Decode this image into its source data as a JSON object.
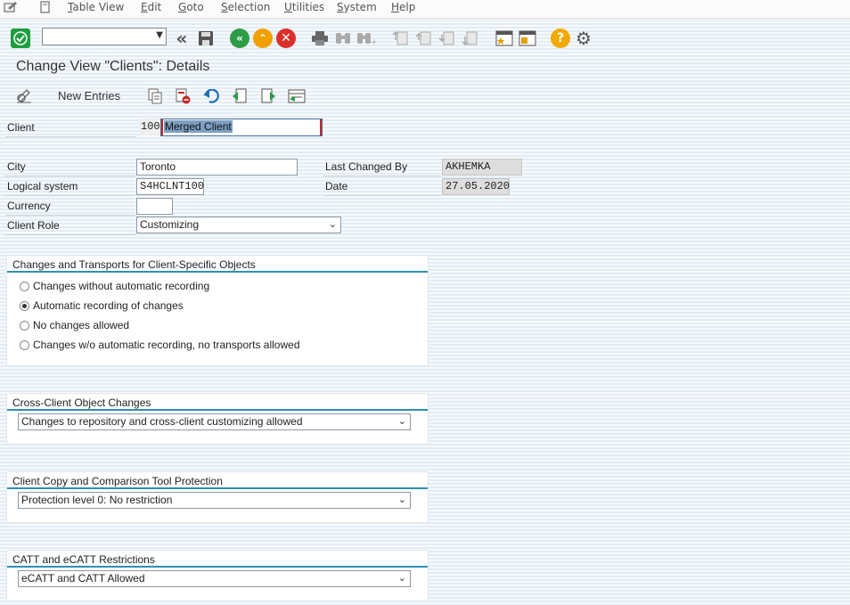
{
  "menu": {
    "items": [
      "Table View",
      "Edit",
      "Goto",
      "Selection",
      "Utilities",
      "System",
      "Help"
    ],
    "mnemonics": [
      "T",
      "E",
      "G",
      "S",
      "U",
      "S",
      "H"
    ]
  },
  "toolbar": {
    "command_field_value": "",
    "icons": [
      "enter-icon",
      "back-double-icon",
      "save-icon",
      "back-icon",
      "exit-icon",
      "cancel-icon",
      "print-icon",
      "find-icon",
      "find-next-icon",
      "first-page-icon",
      "previous-page-icon",
      "next-page-icon",
      "last-page-icon",
      "create-session-icon",
      "shortcut-icon",
      "help-icon",
      "settings-icon"
    ]
  },
  "page": {
    "title": "Change View \"Clients\": Details"
  },
  "app_toolbar": {
    "new_entries_label": "New Entries"
  },
  "form": {
    "client_label": "Client",
    "client_number": "100",
    "client_name": "Merged Client",
    "city_label": "City",
    "city_value": "Toronto",
    "logical_system_label": "Logical system",
    "logical_system_value": "S4HCLNT100",
    "currency_label": "Currency",
    "currency_value": "",
    "client_role_label": "Client Role",
    "client_role_value": "Customizing",
    "last_changed_by_label": "Last Changed By",
    "last_changed_by_value": "AKHEMKA",
    "date_label": "Date",
    "date_value": "27.05.2020"
  },
  "changes_group": {
    "title": "Changes and Transports for Client-Specific Objects",
    "options": [
      "Changes without automatic recording",
      "Automatic recording of changes",
      "No changes allowed",
      "Changes w/o automatic recording, no transports allowed"
    ],
    "selected_index": 1
  },
  "cross_client_group": {
    "title": "Cross-Client Object Changes",
    "value": "Changes to repository and cross-client customizing allowed"
  },
  "copy_protection_group": {
    "title": "Client Copy and Comparison Tool Protection",
    "value": "Protection level 0: No restriction"
  },
  "catt_group": {
    "title": "CATT and eCATT Restrictions",
    "value": "eCATT and CATT Allowed"
  },
  "colors": {
    "accent_rule": "#2d8fb3",
    "enter_green": "#1e9e3f",
    "back_green": "#2c9c45",
    "exit_orange": "#f0a000",
    "cancel_red": "#d9302c",
    "help_yellow": "#f2a900"
  }
}
